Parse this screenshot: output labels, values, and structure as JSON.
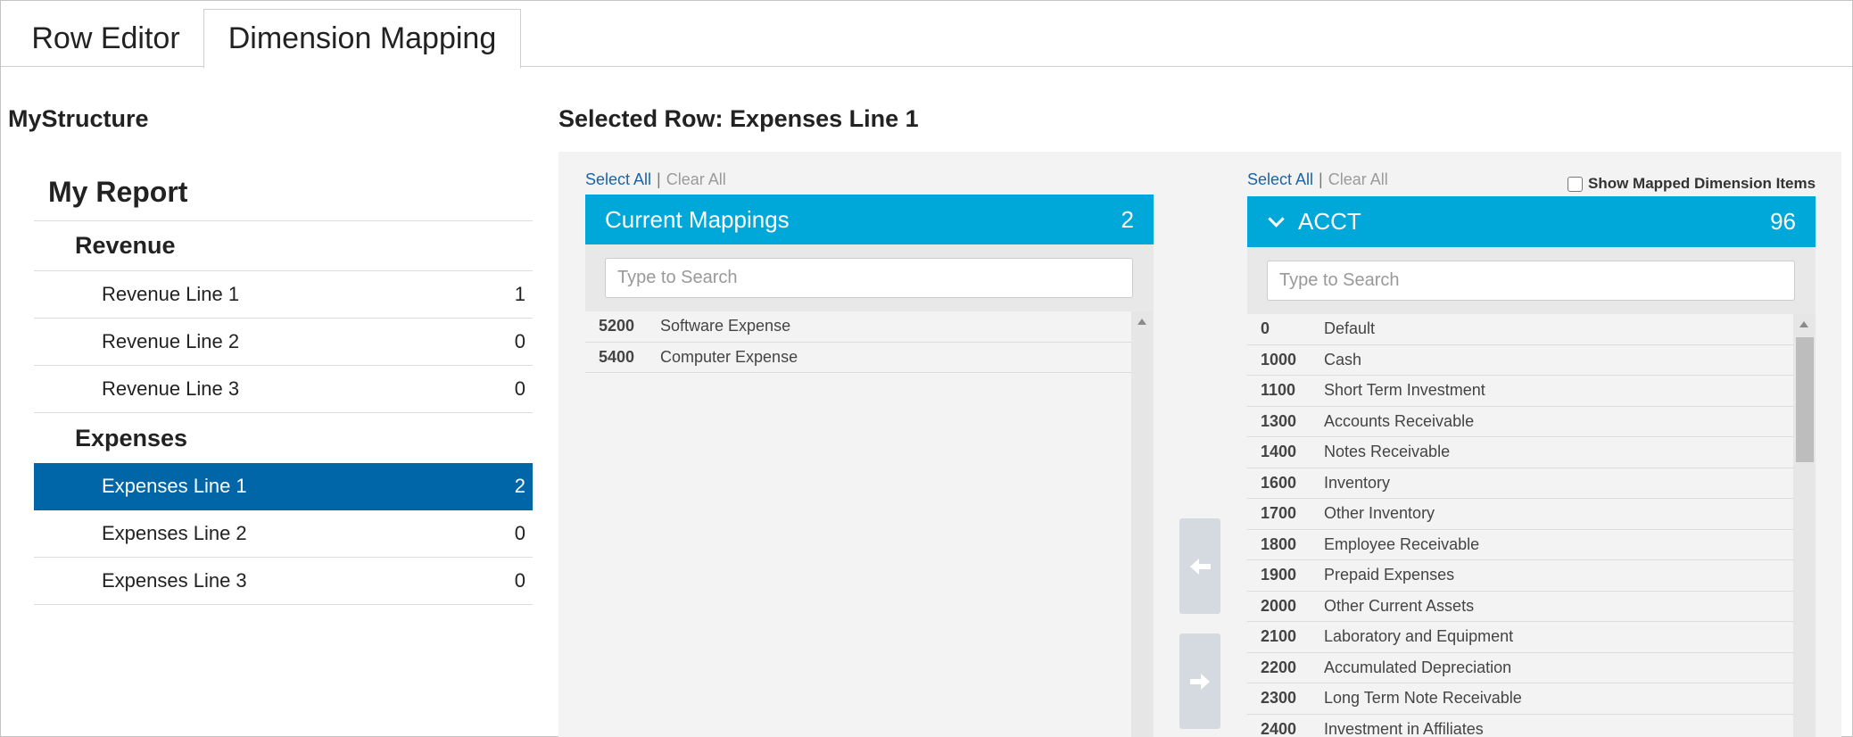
{
  "tabs": {
    "row_editor": "Row Editor",
    "dimension_mapping": "Dimension Mapping"
  },
  "structure": {
    "title": "MyStructure",
    "report_title": "My Report",
    "groups": [
      {
        "label": "Revenue",
        "rows": [
          {
            "label": "Revenue Line 1",
            "count": "1"
          },
          {
            "label": "Revenue Line 2",
            "count": "0"
          },
          {
            "label": "Revenue Line 3",
            "count": "0"
          }
        ]
      },
      {
        "label": "Expenses",
        "rows": [
          {
            "label": "Expenses Line 1",
            "count": "2"
          },
          {
            "label": "Expenses Line 2",
            "count": "0"
          },
          {
            "label": "Expenses Line 3",
            "count": "0"
          }
        ]
      }
    ]
  },
  "selected_row": "Selected Row: Expenses Line 1",
  "links": {
    "select_all": "Select All",
    "separator": "|",
    "clear_all": "Clear All"
  },
  "show_mapped_label": "Show Mapped Dimension Items",
  "current_mappings": {
    "title": "Current Mappings",
    "count": "2",
    "search_placeholder": "Type to Search",
    "items": [
      {
        "code": "5200",
        "name": "Software Expense"
      },
      {
        "code": "5400",
        "name": "Computer Expense"
      }
    ]
  },
  "dimension": {
    "title": "ACCT",
    "count": "96",
    "search_placeholder": "Type to Search",
    "items": [
      {
        "code": "0",
        "name": "Default"
      },
      {
        "code": "1000",
        "name": "Cash"
      },
      {
        "code": "1100",
        "name": "Short Term Investment"
      },
      {
        "code": "1300",
        "name": "Accounts Receivable"
      },
      {
        "code": "1400",
        "name": "Notes Receivable"
      },
      {
        "code": "1600",
        "name": "Inventory"
      },
      {
        "code": "1700",
        "name": "Other Inventory"
      },
      {
        "code": "1800",
        "name": "Employee Receivable"
      },
      {
        "code": "1900",
        "name": "Prepaid Expenses"
      },
      {
        "code": "2000",
        "name": "Other Current Assets"
      },
      {
        "code": "2100",
        "name": "Laboratory and Equipment"
      },
      {
        "code": "2200",
        "name": "Accumulated Depreciation"
      },
      {
        "code": "2300",
        "name": "Long Term Note Receivable"
      },
      {
        "code": "2400",
        "name": "Investment in Affiliates"
      }
    ]
  },
  "colors": {
    "accent": "#00a8d9",
    "selected": "#0066a8",
    "link": "#1a64a6"
  }
}
